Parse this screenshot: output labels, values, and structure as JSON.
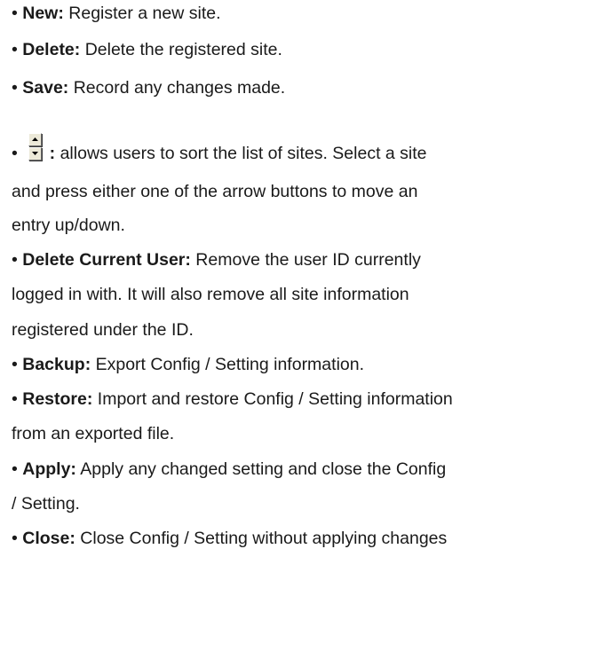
{
  "items": [
    {
      "term": "New:",
      "desc": " Register a new site."
    },
    {
      "term": "Delete:",
      "desc": " Delete the registered site."
    },
    {
      "term": "Save:",
      "desc": " Record any changes made."
    },
    {
      "term": ":",
      "desc": " allows users to sort the list of sites. Select a site",
      "cont": [
        "and press either one of the arrow buttons to move an",
        "entry up/down."
      ]
    },
    {
      "term": "Delete Current User:",
      "desc": " Remove the user ID currently",
      "cont": [
        "logged in with. It will also remove all site information",
        "registered under the ID."
      ]
    },
    {
      "term": "Backup:",
      "desc": " Export Config / Setting information."
    },
    {
      "term": "Restore:",
      "desc": " Import and restore Config / Setting information",
      "cont": [
        "from an exported file."
      ]
    },
    {
      "term": "Apply:",
      "desc": " Apply any changed setting and close the Config",
      "cont": [
        "/ Setting."
      ]
    },
    {
      "term": "Close:",
      "desc": " Close Config / Setting without applying changes"
    }
  ],
  "bullet": "•",
  "icons": {
    "sort_up": "arrow-up-icon",
    "sort_down": "arrow-down-icon"
  }
}
